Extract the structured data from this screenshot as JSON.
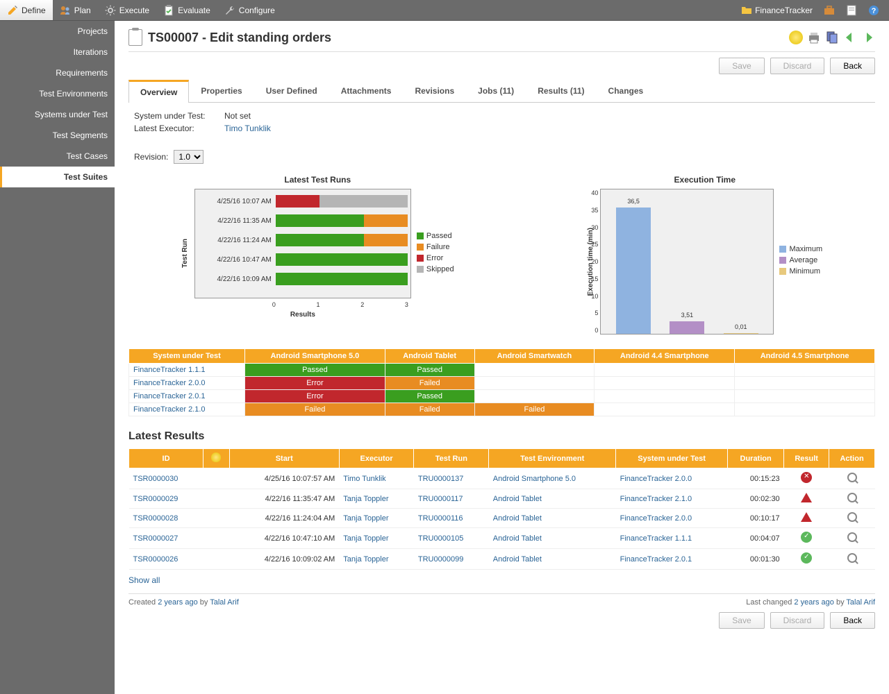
{
  "topbar": {
    "items": [
      {
        "label": "Define",
        "icon": "pencil"
      },
      {
        "label": "Plan",
        "icon": "people"
      },
      {
        "label": "Execute",
        "icon": "gear"
      },
      {
        "label": "Evaluate",
        "icon": "clipboard-check"
      },
      {
        "label": "Configure",
        "icon": "wrench"
      }
    ],
    "project_name": "FinanceTracker"
  },
  "sidebar": {
    "items": [
      "Projects",
      "Iterations",
      "Requirements",
      "Test Environments",
      "Systems under Test",
      "Test Segments",
      "Test Cases",
      "Test Suites"
    ],
    "active_index": 7
  },
  "page": {
    "title": "TS00007 - Edit standing orders",
    "save_label": "Save",
    "discard_label": "Discard",
    "back_label": "Back"
  },
  "tabs": [
    "Overview",
    "Properties",
    "User Defined",
    "Attachments",
    "Revisions",
    "Jobs (11)",
    "Results (11)",
    "Changes"
  ],
  "info": {
    "sut_label": "System under Test:",
    "sut_value": "Not set",
    "exec_label": "Latest Executor:",
    "exec_value": "Timo Tunklik",
    "revision_label": "Revision:",
    "revision_value": "1.0"
  },
  "chart_data": [
    {
      "type": "bar",
      "orientation": "horizontal",
      "stacked": true,
      "title": "Latest Test Runs",
      "xlabel": "Results",
      "ylabel": "Test Run",
      "xlim": [
        0,
        3
      ],
      "xticks": [
        0,
        1,
        2,
        3
      ],
      "categories": [
        "4/25/16 10:07 AM",
        "4/22/16 11:35 AM",
        "4/22/16 11:24 AM",
        "4/22/16 10:47 AM",
        "4/22/16 10:09 AM"
      ],
      "series": [
        {
          "name": "Passed",
          "color": "#3a9e1f",
          "values": [
            0,
            2,
            2,
            3,
            3
          ]
        },
        {
          "name": "Failure",
          "color": "#e88c22",
          "values": [
            0,
            1,
            1,
            0,
            0
          ]
        },
        {
          "name": "Error",
          "color": "#c1272d",
          "values": [
            1,
            0,
            0,
            0,
            0
          ]
        },
        {
          "name": "Skipped",
          "color": "#b5b5b5",
          "values": [
            2,
            0,
            0,
            0,
            0
          ]
        }
      ]
    },
    {
      "type": "bar",
      "title": "Execution Time",
      "ylabel": "Execution time (min)",
      "ylim": [
        0,
        40
      ],
      "yticks": [
        0,
        5,
        10,
        15,
        20,
        25,
        30,
        35,
        40
      ],
      "categories": [
        "Maximum",
        "Average",
        "Minimum"
      ],
      "values": [
        36.5,
        3.51,
        0.01
      ],
      "colors": [
        "#8fb3e0",
        "#b38fc6",
        "#e8c97d"
      ]
    }
  ],
  "matrix": {
    "headers": [
      "System under Test",
      "Android Smartphone 5.0",
      "Android Tablet",
      "Android Smartwatch",
      "Android 4.4 Smartphone",
      "Android 4.5 Smartphone"
    ],
    "rows": [
      {
        "sut": "FinanceTracker 1.1.1",
        "cells": [
          "Passed",
          "Passed",
          "",
          "",
          ""
        ]
      },
      {
        "sut": "FinanceTracker 2.0.0",
        "cells": [
          "Error",
          "Failed",
          "",
          "",
          ""
        ]
      },
      {
        "sut": "FinanceTracker 2.0.1",
        "cells": [
          "Error",
          "Passed",
          "",
          "",
          ""
        ]
      },
      {
        "sut": "FinanceTracker 2.1.0",
        "cells": [
          "Failed",
          "Failed",
          "Failed",
          "",
          ""
        ]
      }
    ]
  },
  "results": {
    "section_title": "Latest Results",
    "headers": [
      "ID",
      "",
      "Start",
      "Executor",
      "Test Run",
      "Test Environment",
      "System under Test",
      "Duration",
      "Result",
      "Action"
    ],
    "rows": [
      {
        "id": "TSR0000030",
        "start": "4/25/16 10:07:57 AM",
        "executor": "Timo Tunklik",
        "run": "TRU0000137",
        "env": "Android Smartphone 5.0",
        "sut": "FinanceTracker 2.0.0",
        "duration": "00:15:23",
        "result": "error"
      },
      {
        "id": "TSR0000029",
        "start": "4/22/16 11:35:47 AM",
        "executor": "Tanja Toppler",
        "run": "TRU0000117",
        "env": "Android Tablet",
        "sut": "FinanceTracker 2.1.0",
        "duration": "00:02:30",
        "result": "warn"
      },
      {
        "id": "TSR0000028",
        "start": "4/22/16 11:24:04 AM",
        "executor": "Tanja Toppler",
        "run": "TRU0000116",
        "env": "Android Tablet",
        "sut": "FinanceTracker 2.0.0",
        "duration": "00:10:17",
        "result": "warn"
      },
      {
        "id": "TSR0000027",
        "start": "4/22/16 10:47:10 AM",
        "executor": "Tanja Toppler",
        "run": "TRU0000105",
        "env": "Android Tablet",
        "sut": "FinanceTracker 1.1.1",
        "duration": "00:04:07",
        "result": "ok"
      },
      {
        "id": "TSR0000026",
        "start": "4/22/16 10:09:02 AM",
        "executor": "Tanja Toppler",
        "run": "TRU0000099",
        "env": "Android Tablet",
        "sut": "FinanceTracker 2.0.1",
        "duration": "00:01:30",
        "result": "ok"
      }
    ],
    "show_all": "Show all"
  },
  "footer": {
    "created_prefix": "Created ",
    "created_time": "2 years ago",
    "created_by": " by ",
    "created_user": "Talal Arif",
    "changed_prefix": "Last changed ",
    "changed_time": "2 years ago",
    "changed_by": " by ",
    "changed_user": "Talal Arif"
  }
}
